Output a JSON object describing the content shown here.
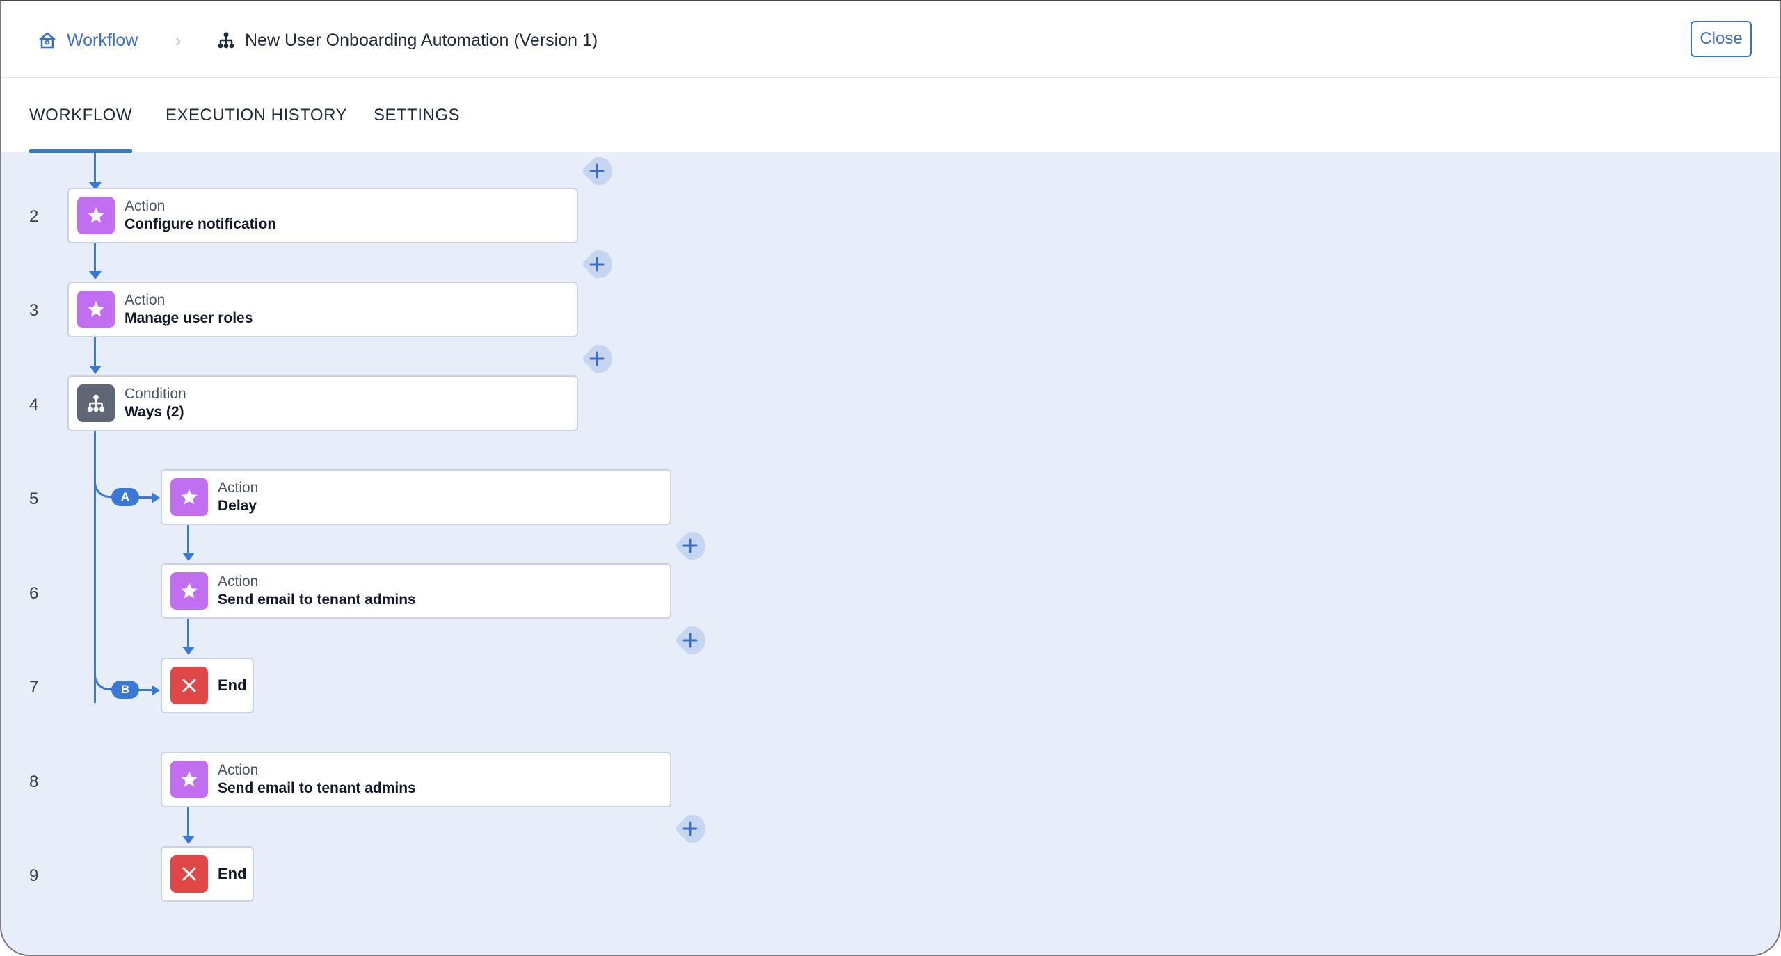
{
  "header": {
    "home_label": "Workflow",
    "separator": "›",
    "page_title": "New User Onboarding Automation (Version 1)",
    "close_label": "Close"
  },
  "tabs": [
    {
      "label": "WORKFLOW",
      "active": true
    },
    {
      "label": "EXECUTION HISTORY",
      "active": false
    },
    {
      "label": "SETTINGS",
      "active": false
    }
  ],
  "colors": {
    "accent": "#3a78d6",
    "action_icon": "#c26ef0",
    "condition_icon": "#5f6675",
    "end_icon": "#e04848",
    "canvas_bg": "#e8eef9"
  },
  "steps": [
    {
      "num": "2",
      "type": "Action",
      "name": "Configure notification",
      "icon": "star-icon"
    },
    {
      "num": "3",
      "type": "Action",
      "name": "Manage user roles",
      "icon": "star-icon"
    },
    {
      "num": "4",
      "type": "Condition",
      "name": "Ways (2)",
      "icon": "branch-icon"
    },
    {
      "num": "5",
      "type": "Action",
      "name": "Delay",
      "icon": "star-icon",
      "branch": "A"
    },
    {
      "num": "6",
      "type": "Action",
      "name": "Send email to tenant admins",
      "icon": "star-icon"
    },
    {
      "num": "7",
      "type": "End",
      "name": "End",
      "icon": "close-icon"
    },
    {
      "num": "8",
      "type": "Action",
      "name": "Send email to tenant admins",
      "icon": "star-icon",
      "branch": "B"
    },
    {
      "num": "9",
      "type": "End",
      "name": "End",
      "icon": "close-icon"
    }
  ],
  "branches": {
    "a": "A",
    "b": "B"
  }
}
